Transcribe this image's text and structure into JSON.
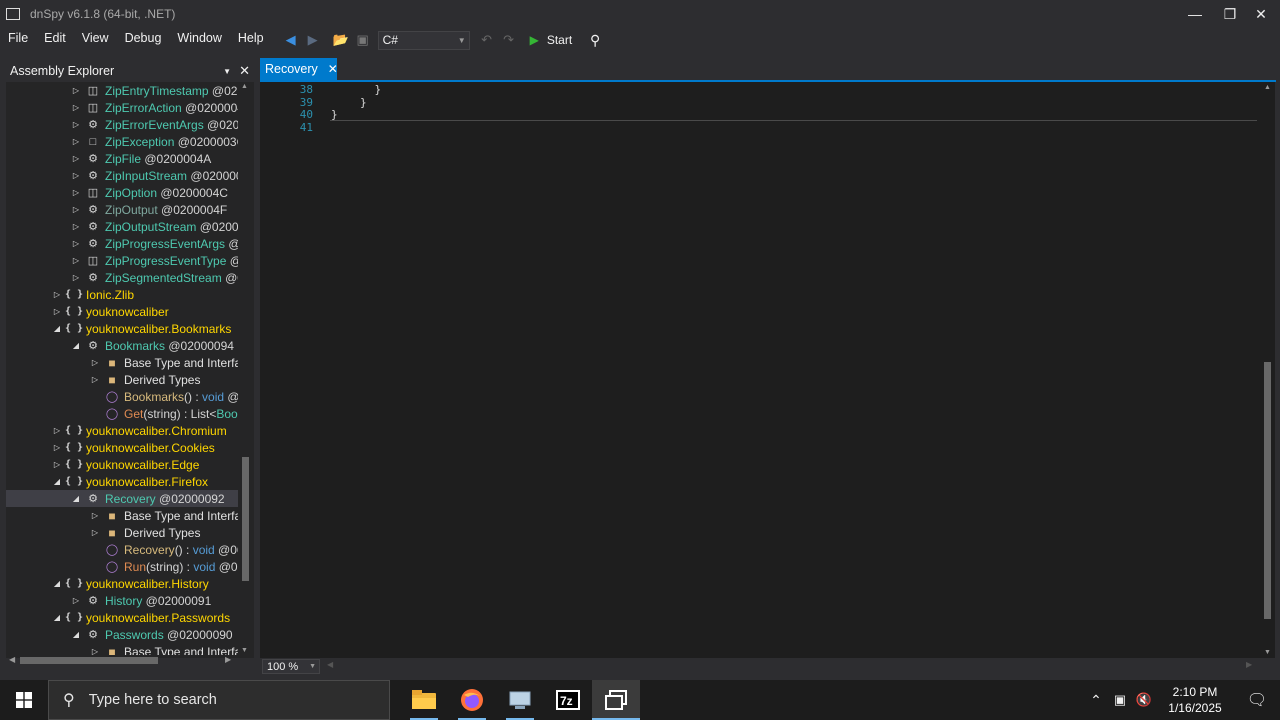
{
  "window": {
    "title": "dnSpy v6.1.8 (64-bit, .NET)"
  },
  "menu": [
    "File",
    "Edit",
    "View",
    "Debug",
    "Window",
    "Help"
  ],
  "toolbar": {
    "language": "C#",
    "start_label": "Start"
  },
  "explorer": {
    "title": "Assembly Explorer",
    "rows": [
      {
        "indent": 3,
        "exp": "▷",
        "icon": "enum",
        "name": "ZipEntryTimestamp",
        "meta": " @020",
        "nc": "c-type"
      },
      {
        "indent": 3,
        "exp": "▷",
        "icon": "enum",
        "name": "ZipErrorAction",
        "meta": " @0200004",
        "nc": "c-type"
      },
      {
        "indent": 3,
        "exp": "▷",
        "icon": "class",
        "name": "ZipErrorEventArgs",
        "meta": " @0200",
        "nc": "c-type"
      },
      {
        "indent": 3,
        "exp": "▷",
        "icon": "exc",
        "name": "ZipException",
        "meta": " @0200003C",
        "nc": "c-type"
      },
      {
        "indent": 3,
        "exp": "▷",
        "icon": "class",
        "name": "ZipFile",
        "meta": " @0200004A",
        "nc": "c-type"
      },
      {
        "indent": 3,
        "exp": "▷",
        "icon": "class",
        "name": "ZipInputStream",
        "meta": " @020000",
        "nc": "c-type"
      },
      {
        "indent": 3,
        "exp": "▷",
        "icon": "enum",
        "name": "ZipOption",
        "meta": " @0200004C",
        "nc": "c-type"
      },
      {
        "indent": 3,
        "exp": "▷",
        "icon": "class",
        "name": "ZipOutput",
        "meta": " @0200004F",
        "nc": "c-dim"
      },
      {
        "indent": 3,
        "exp": "▷",
        "icon": "class",
        "name": "ZipOutputStream",
        "meta": " @02000",
        "nc": "c-type"
      },
      {
        "indent": 3,
        "exp": "▷",
        "icon": "class",
        "name": "ZipProgressEventArgs",
        "meta": " @0",
        "nc": "c-type"
      },
      {
        "indent": 3,
        "exp": "▷",
        "icon": "enum",
        "name": "ZipProgressEventType",
        "meta": " @0",
        "nc": "c-type"
      },
      {
        "indent": 3,
        "exp": "▷",
        "icon": "class",
        "name": "ZipSegmentedStream",
        "meta": " @0",
        "nc": "c-type"
      },
      {
        "indent": 2,
        "exp": "▷",
        "icon": "ns",
        "name": "Ionic.Zlib",
        "meta": "",
        "nc": "c-ns"
      },
      {
        "indent": 2,
        "exp": "▷",
        "icon": "ns",
        "name": "youknowcaliber",
        "meta": "",
        "nc": "c-ns"
      },
      {
        "indent": 2,
        "exp": "◢",
        "icon": "ns",
        "name": "youknowcaliber.Bookmarks",
        "meta": "",
        "nc": "c-ns"
      },
      {
        "indent": 3,
        "exp": "◢",
        "icon": "class",
        "name": "Bookmarks",
        "meta": " @02000094",
        "nc": "c-type"
      },
      {
        "indent": 4,
        "exp": "▷",
        "icon": "folder",
        "name": "Base Type and Interfac",
        "meta": "",
        "nc": "c-plain"
      },
      {
        "indent": 4,
        "exp": "▷",
        "icon": "folder",
        "name": "Derived Types",
        "meta": "",
        "nc": "c-plain"
      },
      {
        "indent": 4,
        "exp": "",
        "icon": "method",
        "name": "Bookmarks",
        "meta": "() : ",
        "kw": "void",
        "tail": " @0",
        "nc": "c-meth"
      },
      {
        "indent": 4,
        "exp": "",
        "icon": "method",
        "name": "Get",
        "meta": "(string) : List<",
        "kw": "",
        "tail": "Book",
        "tailc": "c-type",
        "nc": "c-methr"
      },
      {
        "indent": 2,
        "exp": "▷",
        "icon": "ns",
        "name": "youknowcaliber.Chromium",
        "meta": "",
        "nc": "c-ns"
      },
      {
        "indent": 2,
        "exp": "▷",
        "icon": "ns",
        "name": "youknowcaliber.Cookies",
        "meta": "",
        "nc": "c-ns"
      },
      {
        "indent": 2,
        "exp": "▷",
        "icon": "ns",
        "name": "youknowcaliber.Edge",
        "meta": "",
        "nc": "c-ns"
      },
      {
        "indent": 2,
        "exp": "◢",
        "icon": "ns",
        "name": "youknowcaliber.Firefox",
        "meta": "",
        "nc": "c-ns"
      },
      {
        "indent": 3,
        "exp": "◢",
        "icon": "class",
        "name": "Recovery",
        "meta": " @02000092",
        "nc": "c-type",
        "sel": true
      },
      {
        "indent": 4,
        "exp": "▷",
        "icon": "folder",
        "name": "Base Type and Interfac",
        "meta": "",
        "nc": "c-plain"
      },
      {
        "indent": 4,
        "exp": "▷",
        "icon": "folder",
        "name": "Derived Types",
        "meta": "",
        "nc": "c-plain"
      },
      {
        "indent": 4,
        "exp": "",
        "icon": "method",
        "name": "Recovery",
        "meta": "() : ",
        "kw": "void",
        "tail": " @06",
        "nc": "c-meth"
      },
      {
        "indent": 4,
        "exp": "",
        "icon": "method",
        "name": "Run",
        "meta": "(string) : ",
        "kw": "void",
        "tail": " @06",
        "nc": "c-methr"
      },
      {
        "indent": 2,
        "exp": "◢",
        "icon": "ns",
        "name": "youknowcaliber.History",
        "meta": "",
        "nc": "c-ns"
      },
      {
        "indent": 3,
        "exp": "▷",
        "icon": "class",
        "name": "History",
        "meta": " @02000091",
        "nc": "c-type"
      },
      {
        "indent": 2,
        "exp": "◢",
        "icon": "ns",
        "name": "youknowcaliber.Passwords",
        "meta": "",
        "nc": "c-ns"
      },
      {
        "indent": 3,
        "exp": "◢",
        "icon": "class",
        "name": "Passwords",
        "meta": " @02000090",
        "nc": "c-type"
      },
      {
        "indent": 4,
        "exp": "▷",
        "icon": "folder",
        "name": "Base Type and Interfac",
        "meta": "",
        "nc": "c-plain"
      }
    ]
  },
  "editor": {
    "tab_label": "Recovery",
    "lines": [
      {
        "num": "38",
        "text": "}",
        "indent": 3
      },
      {
        "num": "39",
        "text": "}",
        "indent": 2
      },
      {
        "num": "40",
        "text": "}",
        "indent": 0
      },
      {
        "num": "41",
        "text": "",
        "indent": 0
      }
    ],
    "zoom": "100 %"
  },
  "taskbar": {
    "search_placeholder": "Type here to search",
    "time": "2:10 PM",
    "date": "1/16/2025"
  }
}
